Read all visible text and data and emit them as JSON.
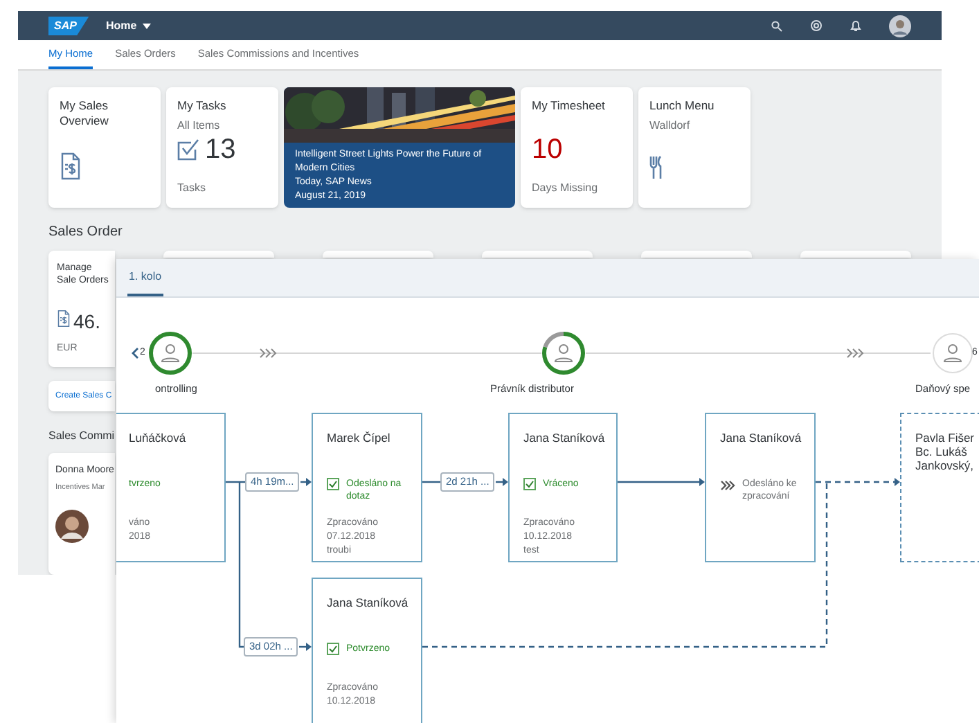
{
  "shell": {
    "logo": "SAP",
    "title": "Home"
  },
  "tabs": [
    {
      "label": "My Home",
      "selected": true
    },
    {
      "label": "Sales Orders",
      "selected": false
    },
    {
      "label": "Sales Commissions and Incentives",
      "selected": false
    }
  ],
  "tiles": [
    {
      "kind": "doc",
      "title": "My Sales Overview"
    },
    {
      "kind": "tasks",
      "title": "My Tasks",
      "subtitle": "All Items",
      "value": "13",
      "footer": "Tasks"
    },
    {
      "kind": "news",
      "headline": "Intelligent Street Lights Power the Future of Modern Cities",
      "source": "Today, SAP News",
      "date": "August 21, 2019"
    },
    {
      "kind": "kpi",
      "title": "My Timesheet",
      "value": "10",
      "footer": "Days Missing"
    },
    {
      "kind": "menu",
      "title": "Lunch Menu",
      "subtitle": "Walldorf"
    }
  ],
  "sales_order": {
    "heading": "Sales Order",
    "tile": {
      "title": "Manage Sale Orders",
      "value": "46.",
      "unit": "EUR"
    },
    "link": "Create Sales C"
  },
  "commissions": {
    "heading": "Sales Commi",
    "card": {
      "name": "Donna Moore",
      "role": "Incentives Mar"
    }
  },
  "process": {
    "tab": {
      "label": "1. kolo",
      "selected": true
    },
    "prev_count": "2",
    "next_count": "6",
    "stages": [
      {
        "label": "ontrolling",
        "kind": "done"
      },
      {
        "label": "Právník distributor",
        "kind": "active"
      },
      {
        "label": "Daňový spe",
        "kind": "open"
      }
    ],
    "nodes": [
      {
        "kind": "done",
        "name": "Luňáčková",
        "status": "tvrzeno",
        "lines": [
          "váno",
          "2018"
        ]
      },
      {
        "kind": "done",
        "name": "Marek Čípel",
        "status": "Odesláno na dotaz",
        "lines": [
          "Zpracováno",
          "07.12.2018",
          "troubi"
        ]
      },
      {
        "kind": "done",
        "name": "Jana Staníková",
        "status": "Vráceno",
        "lines": [
          "Zpracováno",
          "10.12.2018",
          "test"
        ]
      },
      {
        "kind": "sent",
        "name": "Jana Staníková",
        "status": "Odesláno ke zpracování"
      },
      {
        "kind": "planned",
        "name": "Pavla Fišer Bc. Lukáš Jankovský,"
      },
      {
        "kind": "done",
        "name": "Jana Staníková",
        "status": "Potvrzeno",
        "lines": [
          "Zpracováno",
          "10.12.2018"
        ]
      }
    ],
    "durations": [
      "4h 19m...",
      "2d 21h ...",
      "3d 02h ..."
    ]
  }
}
